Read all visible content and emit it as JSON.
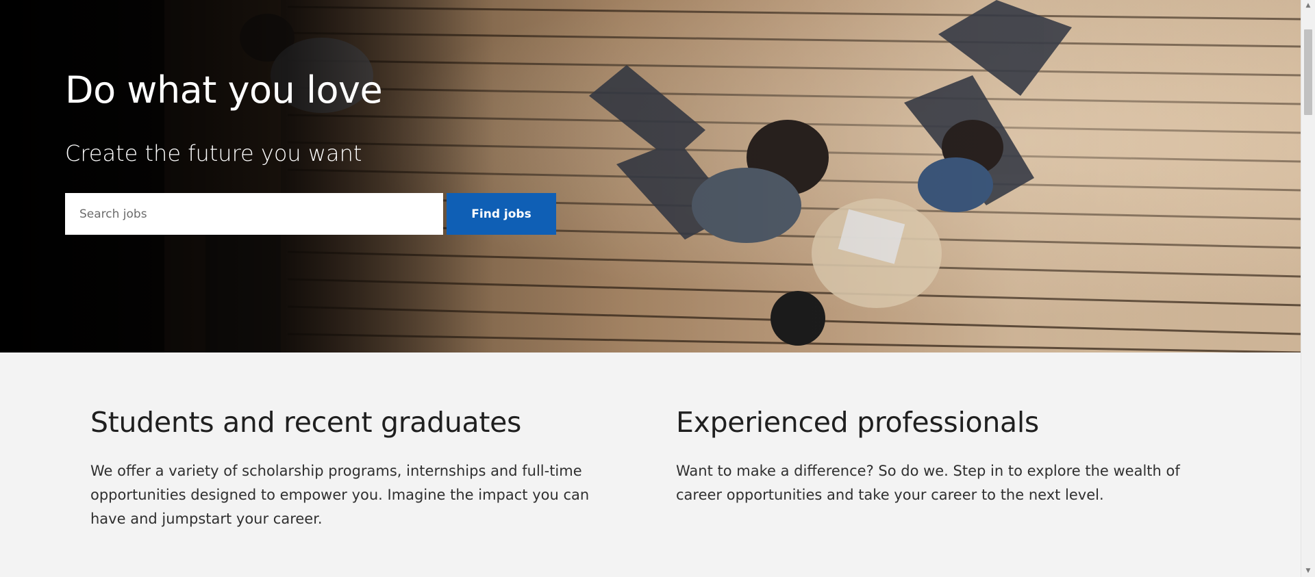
{
  "hero": {
    "title": "Do what you love",
    "subtitle": "Create the future you want",
    "search": {
      "placeholder": "Search jobs",
      "value": ""
    },
    "find_button_label": "Find jobs"
  },
  "sections": [
    {
      "heading": "Students and recent graduates",
      "body": "We offer a variety of scholarship programs, internships and full-time opportunities designed to empower you. Imagine the impact you can have and jumpstart your career."
    },
    {
      "heading": "Experienced professionals",
      "body": "Want to make a difference? So do we. Step in to explore the wealth of career opportunities and take your career to the next level."
    }
  ],
  "colors": {
    "accent_button": "#0f5fb5",
    "content_background": "#f3f3f3",
    "hero_text": "#ffffff"
  },
  "icons": {
    "scroll_up": "scroll-up-arrow-icon",
    "scroll_down": "scroll-down-arrow-icon"
  }
}
